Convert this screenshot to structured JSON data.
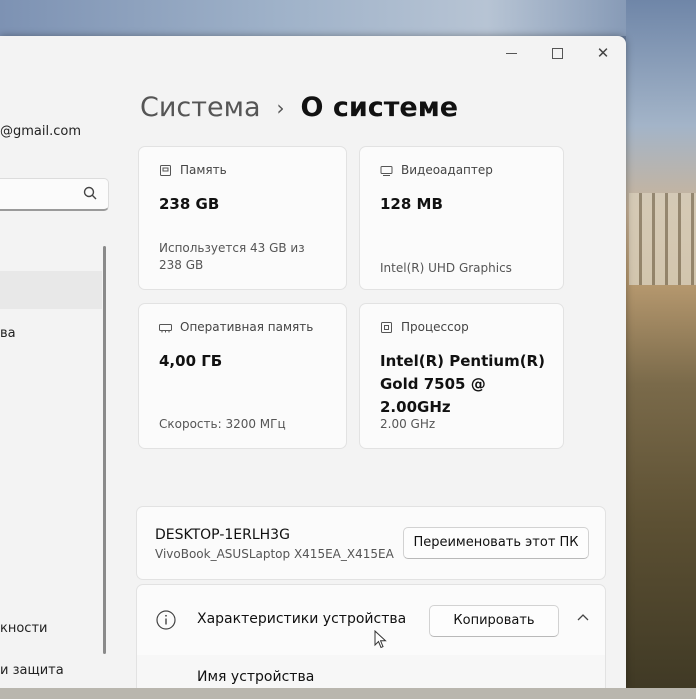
{
  "window_controls": {
    "close": "✕"
  },
  "account": {
    "email_fragment": "@gmail.com"
  },
  "sidebar": {
    "items": [
      {
        "label": "ва",
        "top": 0
      },
      {
        "label": "кности"
      },
      {
        "label": "и защита"
      }
    ]
  },
  "breadcrumb": {
    "parent": "Система",
    "separator": "›",
    "current": "О системе"
  },
  "cards": {
    "memory": {
      "title": "Память",
      "value": "238 GB",
      "sub": "Используется 43 GB из 238 GB"
    },
    "video": {
      "title": "Видеоадаптер",
      "value": "128 MB",
      "sub": "Intel(R) UHD Graphics"
    },
    "ram": {
      "title": "Оперативная память",
      "value": "4,00 ГБ",
      "sub": "Скорость: 3200 МГц"
    },
    "cpu": {
      "title": "Процессор",
      "value": "Intel(R) Pentium(R) Gold 7505 @ 2.00GHz",
      "sub": "2.00 GHz"
    }
  },
  "device": {
    "name": "DESKTOP-1ERLH3G",
    "model": "VivoBook_ASUSLaptop X415EA_X415EA",
    "rename_label": "Переименовать этот ПК"
  },
  "specs": {
    "title": "Характеристики устройства",
    "copy_label": "Копировать",
    "device_name_label": "Имя устройства"
  },
  "colors": {
    "window_bg": "#f3f3f3",
    "card_bg": "#fbfbfb",
    "text": "#111111"
  }
}
